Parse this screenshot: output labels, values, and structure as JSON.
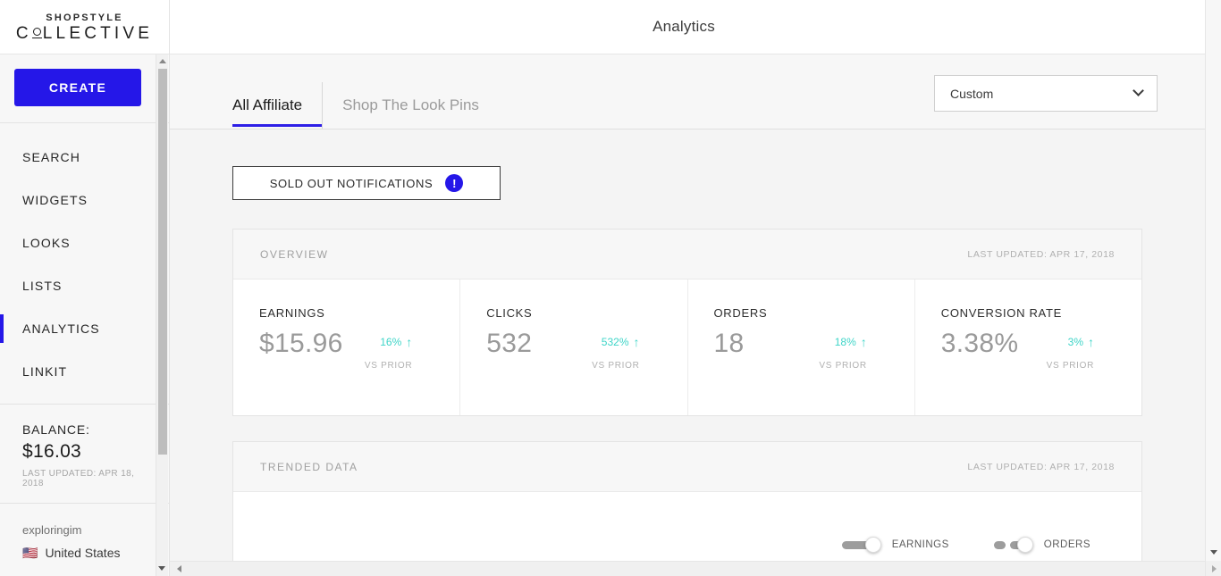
{
  "brand": {
    "line1": "SHOPSTYLE",
    "line2_before": "C",
    "line2_after": "LLECTIVE"
  },
  "header": {
    "title": "Analytics"
  },
  "sidebar": {
    "create_label": "CREATE",
    "items": [
      {
        "label": "SEARCH",
        "active": false
      },
      {
        "label": "WIDGETS",
        "active": false
      },
      {
        "label": "LOOKS",
        "active": false
      },
      {
        "label": "LISTS",
        "active": false
      },
      {
        "label": "ANALYTICS",
        "active": true
      },
      {
        "label": "LINKIT",
        "active": false
      }
    ],
    "balance": {
      "label": "BALANCE:",
      "value": "$16.03",
      "updated": "LAST UPDATED: APR 18, 2018"
    },
    "user": {
      "name": "exploringim",
      "flag": "🇺🇸",
      "country": "United States"
    }
  },
  "tabs": [
    {
      "label": "All Affiliate",
      "active": true
    },
    {
      "label": "Shop The Look Pins",
      "active": false
    }
  ],
  "date_filter": {
    "value": "Custom",
    "icon": "chevron-down-icon"
  },
  "soldout": {
    "label": "SOLD OUT NOTIFICATIONS",
    "badge": "!"
  },
  "overview_card": {
    "title": "OVERVIEW",
    "updated": "LAST UPDATED: APR 17, 2018",
    "metrics": [
      {
        "label": "EARNINGS",
        "value": "$15.96",
        "delta": "16%",
        "arrow": "↑",
        "vs": "VS PRIOR"
      },
      {
        "label": "CLICKS",
        "value": "532",
        "delta": "532%",
        "arrow": "↑",
        "vs": "VS PRIOR"
      },
      {
        "label": "ORDERS",
        "value": "18",
        "delta": "18%",
        "arrow": "↑",
        "vs": "VS PRIOR"
      },
      {
        "label": "CONVERSION RATE",
        "value": "3.38%",
        "delta": "3%",
        "arrow": "↑",
        "vs": "VS PRIOR"
      }
    ]
  },
  "trended_card": {
    "title": "TRENDED DATA",
    "updated": "LAST UPDATED: APR 17, 2018",
    "toggles": [
      {
        "label": "EARNINGS",
        "style": "solid",
        "on": true
      },
      {
        "label": "ORDERS",
        "style": "dashed",
        "on": true
      }
    ]
  },
  "colors": {
    "accent_blue": "#2517e8",
    "delta_teal": "#3fd5c8",
    "page_bg": "#f4f4f4",
    "sidebar_bg": "#f7f7f7"
  }
}
